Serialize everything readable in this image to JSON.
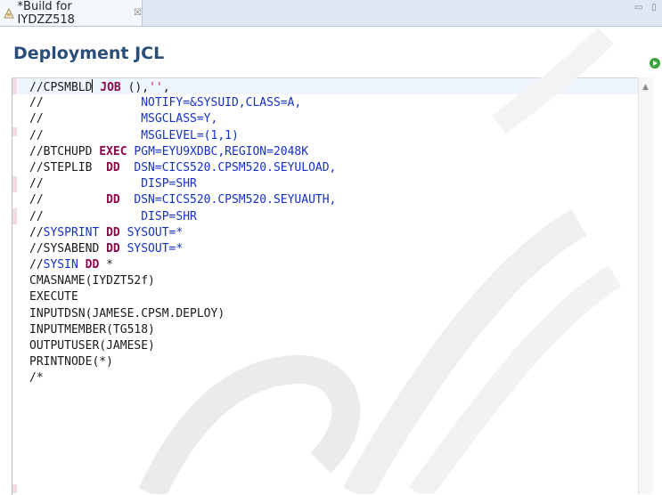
{
  "tab": {
    "title": "*Build for IYDZZ518",
    "close": "☒"
  },
  "window_controls": {
    "minimize": "▭",
    "maximize": "▯"
  },
  "header": {
    "title": "Deployment JCL"
  },
  "code": {
    "lines": [
      [
        {
          "t": "//CPSMBLD"
        },
        {
          "t": "|",
          "caret": true
        },
        {
          "t": " "
        },
        {
          "t": "JOB",
          "c": "kw"
        },
        {
          "t": " (),"
        },
        {
          "t": "''",
          "c": "str"
        },
        {
          "t": ","
        }
      ],
      [
        {
          "t": "//              "
        },
        {
          "t": "NOTIFY=&SYSUID,CLASS=A,",
          "c": "val"
        }
      ],
      [
        {
          "t": "//              "
        },
        {
          "t": "MSGCLASS=Y,",
          "c": "val"
        }
      ],
      [
        {
          "t": "//              "
        },
        {
          "t": "MSGLEVEL=(1,1)",
          "c": "val"
        }
      ],
      [
        {
          "t": "//BTCHUPD "
        },
        {
          "t": "EXEC",
          "c": "kw"
        },
        {
          "t": " "
        },
        {
          "t": "PGM=EYU9XDBC,REGION=2048K",
          "c": "val"
        }
      ],
      [
        {
          "t": "//STEPLIB  "
        },
        {
          "t": "DD",
          "c": "kw"
        },
        {
          "t": "  "
        },
        {
          "t": "DSN=CICS520.CPSM520.SEYULOAD,",
          "c": "val"
        }
      ],
      [
        {
          "t": "//              "
        },
        {
          "t": "DISP=SHR",
          "c": "val"
        }
      ],
      [
        {
          "t": "//         "
        },
        {
          "t": "DD",
          "c": "kw"
        },
        {
          "t": "  "
        },
        {
          "t": "DSN=CICS520.CPSM520.SEYUAUTH,",
          "c": "val"
        }
      ],
      [
        {
          "t": "//              "
        },
        {
          "t": "DISP=SHR",
          "c": "val"
        }
      ],
      [
        {
          "t": "//"
        },
        {
          "t": "SYSPRINT",
          "c": "dd"
        },
        {
          "t": " "
        },
        {
          "t": "DD",
          "c": "kw"
        },
        {
          "t": " "
        },
        {
          "t": "SYSOUT=*",
          "c": "val"
        }
      ],
      [
        {
          "t": "//SYSABEND "
        },
        {
          "t": "DD",
          "c": "kw"
        },
        {
          "t": " "
        },
        {
          "t": "SYSOUT=*",
          "c": "val"
        }
      ],
      [
        {
          "t": "//"
        },
        {
          "t": "SYSIN",
          "c": "dd"
        },
        {
          "t": " "
        },
        {
          "t": "DD",
          "c": "kw"
        },
        {
          "t": " *"
        }
      ],
      [
        {
          "t": "CMASNAME(IYDZT52f)"
        }
      ],
      [
        {
          "t": "EXECUTE"
        }
      ],
      [
        {
          "t": "INPUTDSN(JAMESE.CPSM.DEPLOY)"
        }
      ],
      [
        {
          "t": "INPUTMEMBER(TG518)"
        }
      ],
      [
        {
          "t": "OUTPUTUSER(JAMESE)"
        }
      ],
      [
        {
          "t": "PRINTNODE(*)"
        }
      ],
      [
        {
          "t": "/*"
        }
      ]
    ]
  },
  "colors": {
    "title": "#2a4d7a",
    "keyword": "#8b0a4c",
    "value": "#1631c9",
    "string": "#d20077"
  },
  "icons": {
    "tab": "editor-file-icon",
    "run": "run-icon",
    "scroll_up": "scroll-up-arrow-icon"
  }
}
